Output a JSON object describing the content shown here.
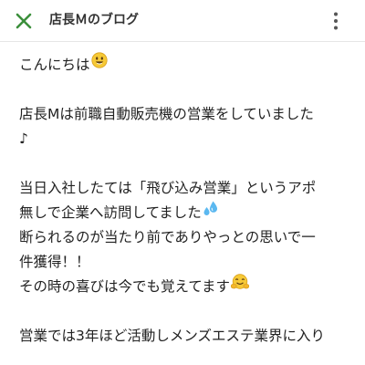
{
  "header": {
    "title": "店長Ｍのブログ",
    "close_icon": "close-x-icon",
    "menu_icon": "more-vertical-icon",
    "accent_color": "#3b8f3b"
  },
  "article": {
    "paragraphs": [
      {
        "lines": [
          {
            "text": "こんにちは",
            "emoji": "smiling-face-icon"
          }
        ]
      },
      {
        "lines": [
          {
            "text": "店長Mは前職自動販売機の営業をしていました"
          },
          {
            "text": "♪"
          }
        ]
      },
      {
        "lines": [
          {
            "text": "当日入社したては「飛び込み営業」というアポ"
          },
          {
            "text": "無しで企業へ訪問してました",
            "emoji": "sweat-droplets-icon"
          },
          {
            "text": "断られるのが当たり前でありやっとの思いで一"
          },
          {
            "text": "件獲得！！"
          },
          {
            "text": "その時の喜びは今でも覚えてます",
            "emoji": "hugging-face-icon"
          }
        ]
      },
      {
        "lines": [
          {
            "text": "営業では3年ほど活動しメンズエステ業界に入り"
          }
        ]
      }
    ]
  }
}
